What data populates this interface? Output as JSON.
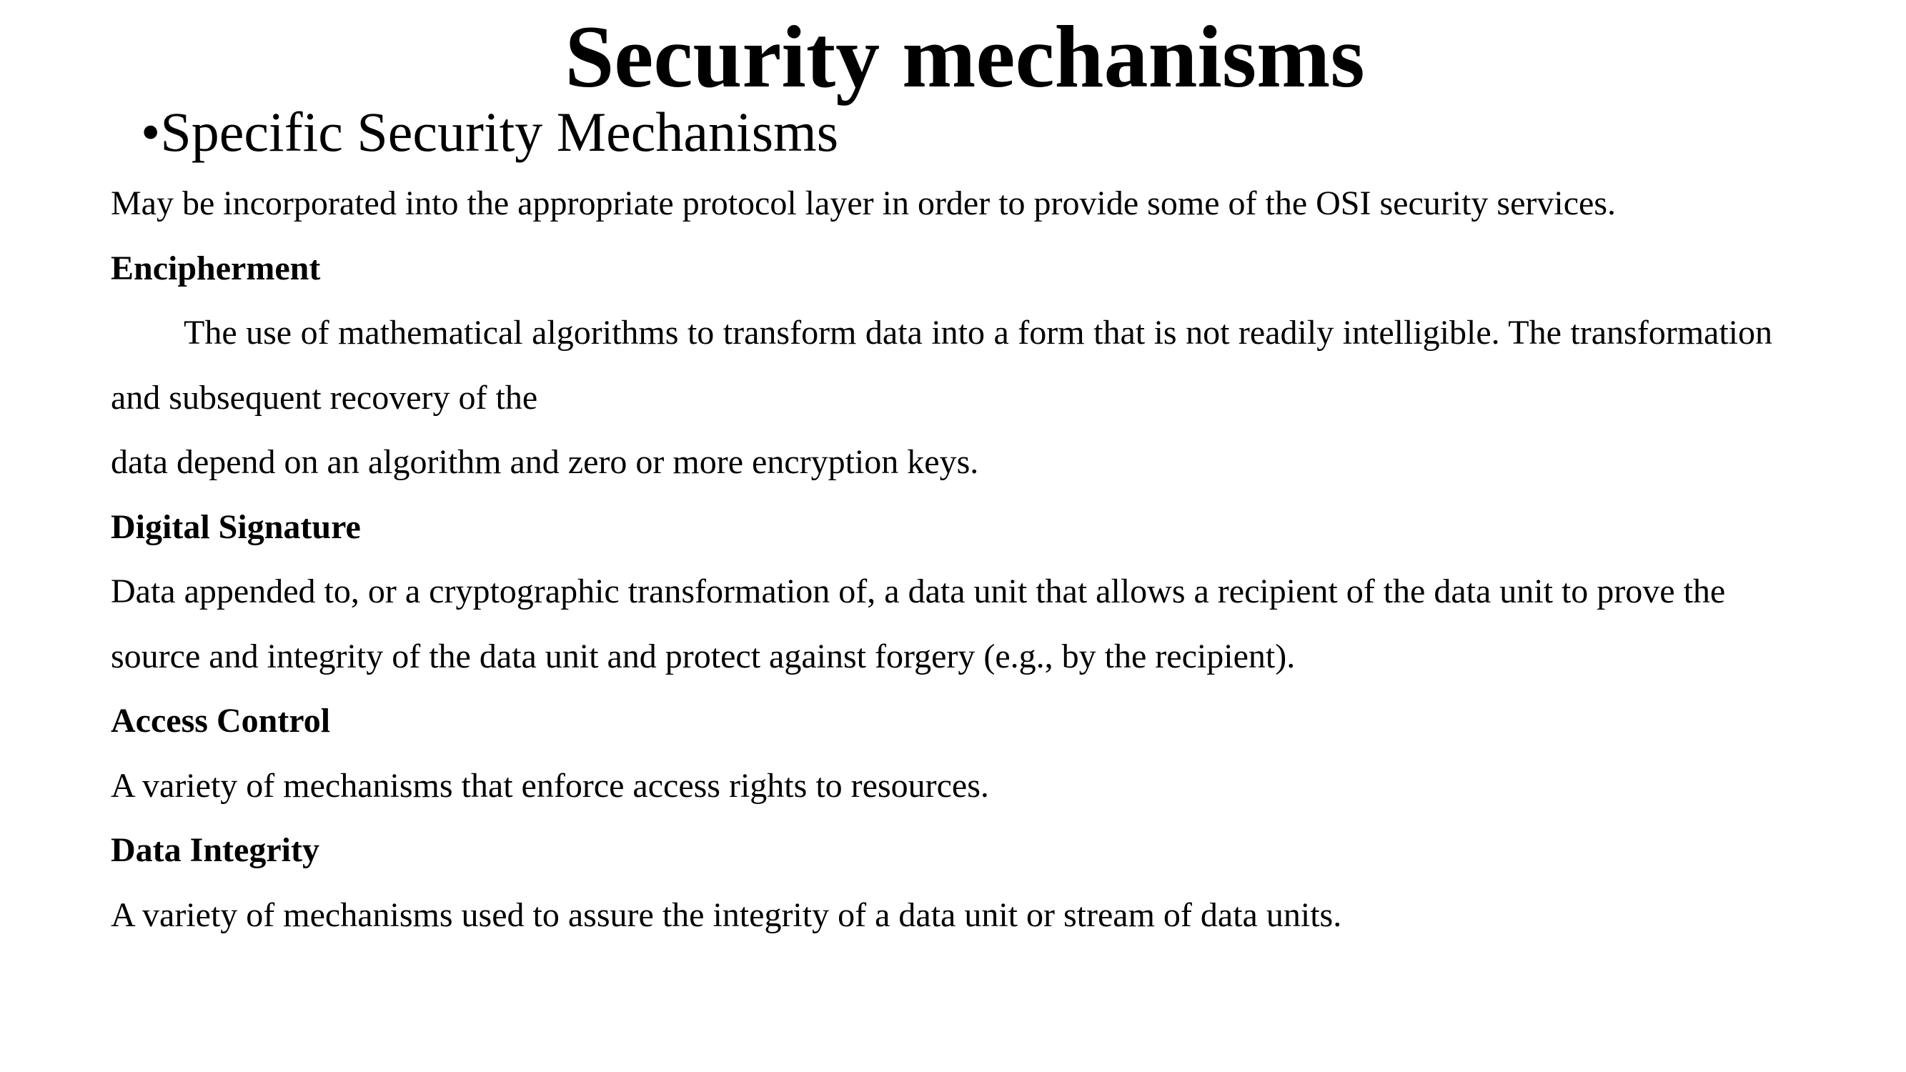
{
  "slide": {
    "title": "Security mechanisms",
    "subtitle": {
      "bullet": "•",
      "text": "Specific Security Mechanisms"
    },
    "intro": "May be incorporated into the appropriate protocol layer in order to provide some of the OSI security services.",
    "sections": [
      {
        "heading": "Encipherment",
        "body_line1": "The use of mathematical algorithms to transform data into a form that is not readily intelligible. The transformation and subsequent recovery of the",
        "body_line2": "data depend on an algorithm and zero or more encryption keys."
      },
      {
        "heading": "Digital Signature",
        "body": "Data appended to, or a cryptographic transformation of, a data unit that allows a recipient of the data unit to prove the source and integrity of the data unit and protect against forgery (e.g., by the recipient)."
      },
      {
        "heading": "Access Control",
        "body": "A variety of mechanisms that enforce access rights to resources."
      },
      {
        "heading": "Data Integrity",
        "body": "A variety of mechanisms used to assure the integrity of a data unit or stream of data units."
      }
    ]
  }
}
